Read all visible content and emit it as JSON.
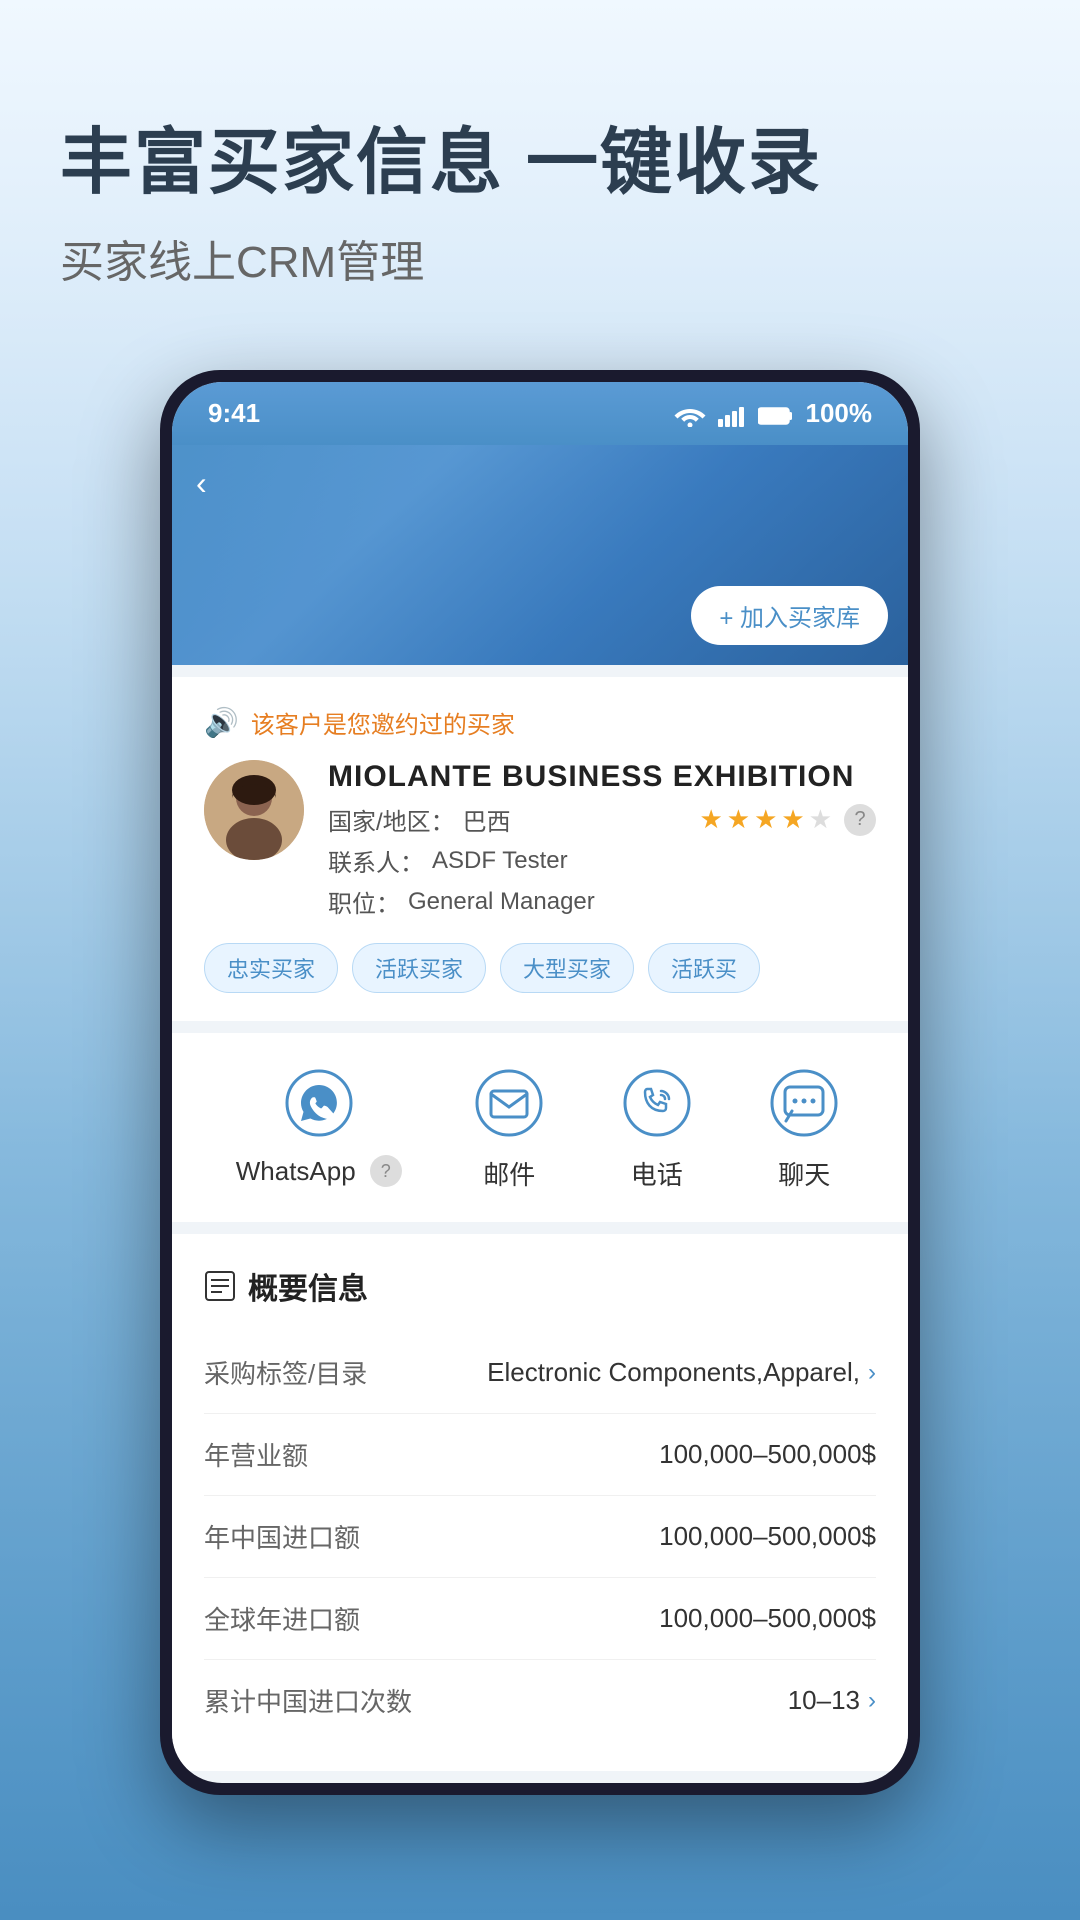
{
  "header": {
    "headline": "丰富买家信息 一键收录",
    "subtitle": "买家线上CRM管理"
  },
  "status_bar": {
    "time": "9:41",
    "battery": "100%"
  },
  "phone": {
    "back_btn": "‹",
    "add_buyer_btn": "+ 加入买家库"
  },
  "customer_notice": "该客户是您邀约过的买家",
  "company": {
    "name": "MIOLANTE BUSINESS EXHIBITION",
    "country_label": "国家/地区：",
    "country": "巴西",
    "contact_label": "联系人：",
    "contact": "ASDF Tester",
    "position_label": "职位：",
    "position": "General Manager",
    "stars_filled": 4,
    "stars_total": 5
  },
  "tags": [
    "忠实买家",
    "活跃买家",
    "大型买家",
    "活跃买"
  ],
  "contacts": [
    {
      "label": "WhatsApp",
      "has_help": true
    },
    {
      "label": "邮件",
      "has_help": false
    },
    {
      "label": "电话",
      "has_help": false
    },
    {
      "label": "聊天",
      "has_help": false
    }
  ],
  "section_title": "概要信息",
  "info_items": [
    {
      "label": "采购标签/目录",
      "value": "Electronic Components,Apparel,",
      "has_chevron": true
    },
    {
      "label": "年营业额",
      "value": "100,000–500,000$",
      "has_chevron": false
    },
    {
      "label": "年中国进口额",
      "value": "100,000–500,000$",
      "has_chevron": false
    },
    {
      "label": "全球年进口额",
      "value": "100,000–500,000$",
      "has_chevron": false
    },
    {
      "label": "累计中国进口次数",
      "value": "10–13",
      "has_chevron": true
    }
  ]
}
